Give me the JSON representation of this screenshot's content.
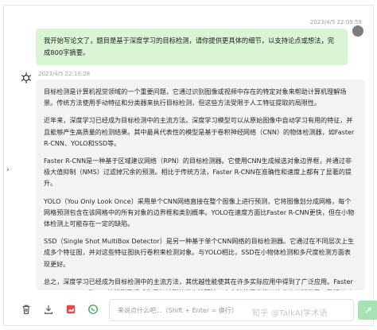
{
  "user_message": {
    "timestamp": "2023/4/5 22:09:59",
    "text": "我开始写论文了，题目是基于深度学习的目标检测，请你提供更具体的细节，以支持论点或想法，完成800字摘要。"
  },
  "ai_message": {
    "timestamp": "2023/4/5 22:10:28",
    "paragraphs": [
      "目标检测是计算机视觉领域的一个重要问题，它通过识别图像或视频中存在的特定对象来帮助计算机理解场景。传统方法使用手动特征和分类器来执行目标检测，但这些方法受限于人工特征提取的局限性。",
      "近年来，深度学习已经成为目标检测中的主流方法。深度学习模型可以从原始图像中自动学习有用的特征，并且能够产生高质量的检测结果。其中最具代表性的模型是基于卷积神经网络（CNN）的物体检测器，如Faster R-CNN、YOLO和SSD等。",
      "Faster R-CNN是一种基于区域建议网络（RPN）的目标检测器。它使用CNN生成候选对象边界框，并通过非极大值抑制（NMS）过滤掉冗余的预测。相比于传统方法，Faster R-CNN在准确性和速度上都有了显著的提升。",
      "YOLO（You Only Look Once）采用单个CNN网络直接在整个图像上进行预测，它将图像划分成网格，每个网格预测包含在该网格中的所有对象的边界框和类别概率。YOLO在速度方面比Faster R-CNN更快，但在小物体检测上可能存在一定的缺陷。",
      "SSD（Single Shot MultiBox Detector）是另一种基于单个CNN网络的目标检测器。它通过在不同层次上生成多个特征图，并对这些特征图执行卷积来检测对象。与YOLO相比，SSD在小物体检测和多尺度检测方面表现更好。",
      "总之，深度学习已经成为目标检测中的主流方法，其优越性能使其在许多实际应用中得到了广泛应用。Faster R-CNN、YOLO和SSD等模型已经成为目标检测的代表性算法，未来随着深度学习技术的不断发展，我们可以期待更加高效和精确的目标检测方法的出现。"
    ]
  },
  "input": {
    "placeholder": "来说点什么吧...（Shift + Enter = 换行）"
  },
  "toolbar": {
    "icons": [
      "trash-icon",
      "download-icon",
      "image-export-icon",
      "whatsapp-like-icon"
    ]
  },
  "send_icon": "send-icon",
  "watermark": "知乎 @TalkAI学术语"
}
